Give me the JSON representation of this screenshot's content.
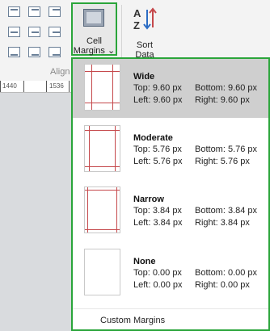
{
  "ribbon": {
    "group_label": "Align",
    "cell_margins": {
      "line1": "Cell",
      "line2": "Margins ⌄"
    },
    "sort": {
      "line1": "Sort",
      "line2": "Data"
    }
  },
  "ruler": {
    "marks": [
      "1440",
      "1536"
    ]
  },
  "dropdown": {
    "options": [
      {
        "title": "Wide",
        "top": "Top: 9.60 px",
        "bottom": "Bottom: 9.60 px",
        "left": "Left: 9.60 px",
        "right": "Right: 9.60 px",
        "selected": true
      },
      {
        "title": "Moderate",
        "top": "Top: 5.76 px",
        "bottom": "Bottom: 5.76 px",
        "left": "Left: 5.76 px",
        "right": "Right: 5.76 px",
        "selected": false
      },
      {
        "title": "Narrow",
        "top": "Top: 3.84 px",
        "bottom": "Bottom: 3.84 px",
        "left": "Left: 3.84 px",
        "right": "Right: 3.84 px",
        "selected": false
      },
      {
        "title": "None",
        "top": "Top: 0.00 px",
        "bottom": "Bottom: 0.00 px",
        "left": "Left: 0.00 px",
        "right": "Right: 0.00 px",
        "selected": false
      }
    ],
    "custom_label": "Custom Margins"
  },
  "colors": {
    "highlight_border": "#2aa53a",
    "margin_line": "#c5484b",
    "selected_bg": "#cfcfcf"
  }
}
